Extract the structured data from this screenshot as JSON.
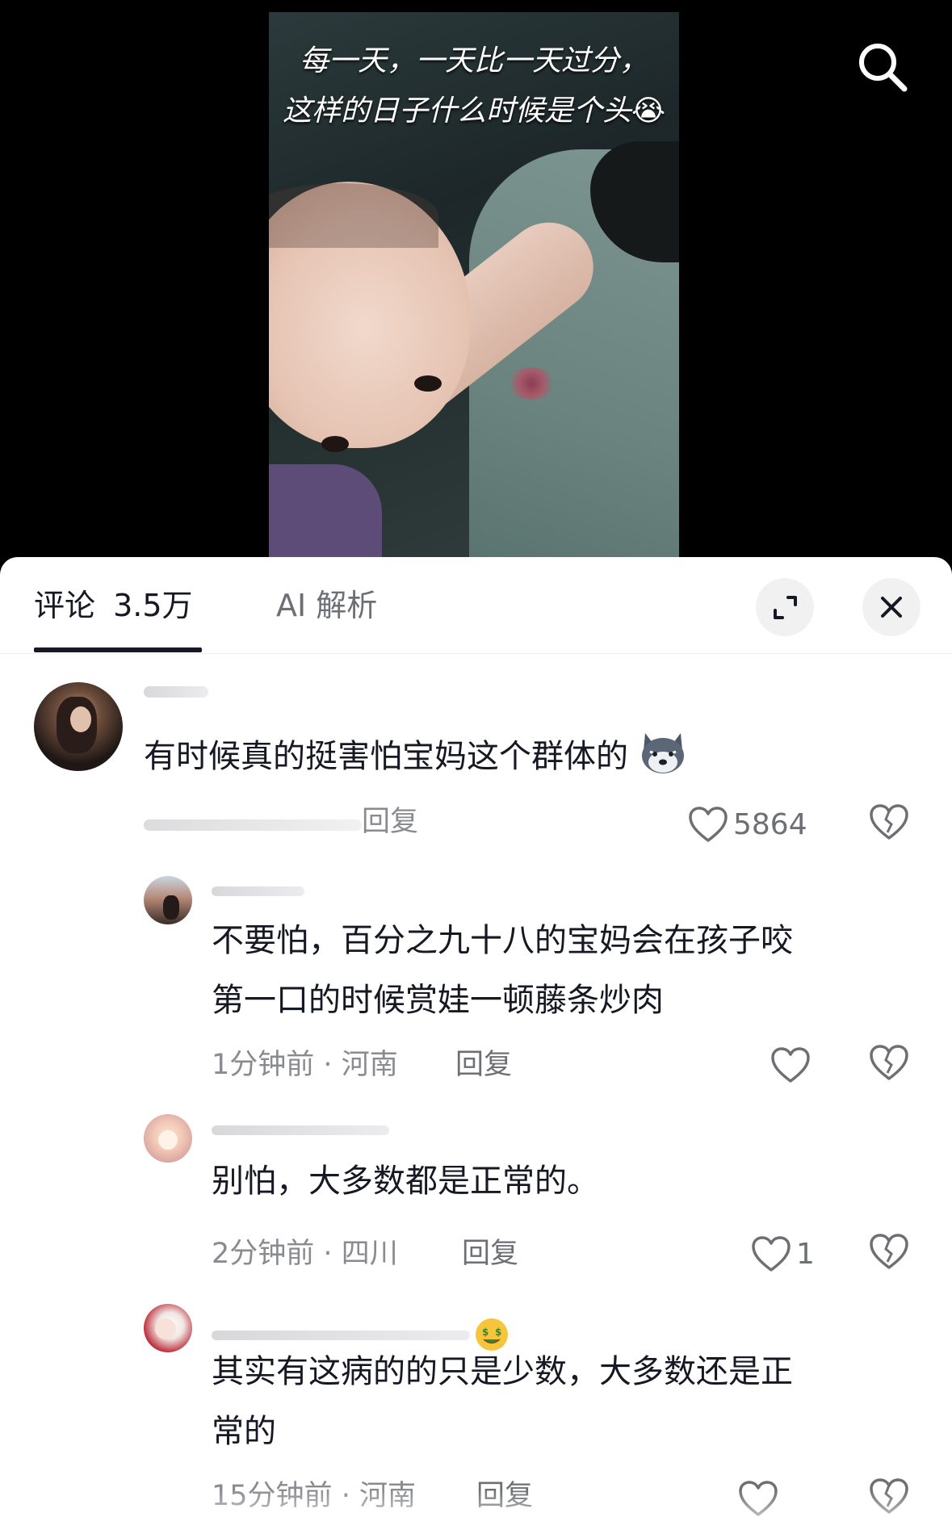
{
  "video": {
    "caption_lines": [
      "每一天，一天比一天过分，",
      "这样的日子什么时候是个头"
    ],
    "caption_emoji": "😭",
    "search_icon": "search-icon"
  },
  "tabs": {
    "comments_label": "评论",
    "comments_count": "3.5万",
    "ai_label": "AI 解析",
    "expand_icon": "expand-icon",
    "close_icon": "close-icon"
  },
  "comments": [
    {
      "text": "有时候真的挺害怕宝妈这个群体的",
      "reply_label": "回复",
      "likes": "5864"
    },
    {
      "text_lines": [
        "不要怕，百分之九十八的宝妈会在孩子咬",
        "第一口的时候赏娃一顿藤条炒肉"
      ],
      "time": "1分钟前",
      "location": "河南",
      "reply_label": "回复",
      "likes": ""
    },
    {
      "text": "别怕，大多数都是正常的。",
      "time": "2分钟前",
      "location": "四川",
      "reply_label": "回复",
      "likes": "1"
    },
    {
      "text_lines": [
        "其实有这病的的只是少数，大多数还是正",
        "常的"
      ],
      "time": "15分钟前",
      "location": "河南",
      "reply_label": "回复",
      "likes": ""
    }
  ],
  "colors": {
    "sheet_bg": "#ffffff",
    "text_primary": "#161823",
    "text_secondary": "#8a8b91",
    "button_bg": "#f1f1f2"
  }
}
